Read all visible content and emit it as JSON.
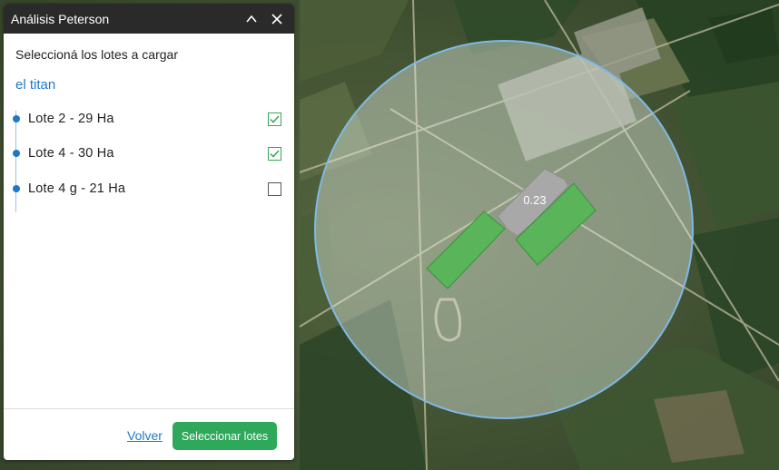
{
  "panel": {
    "title": "Análisis Peterson",
    "instruction": "Seleccioná los lotes a cargar",
    "farm": "el titan",
    "lots": [
      {
        "label": "Lote 2 - 29 Ha",
        "checked": true
      },
      {
        "label": "Lote 4 - 30 Ha",
        "checked": true
      },
      {
        "label": "Lote 4 g - 21 Ha",
        "checked": false
      }
    ],
    "back_label": "Volver",
    "select_label": "Seleccionar lotes"
  },
  "map": {
    "lot_value_label": "0.23"
  },
  "colors": {
    "accent_blue": "#1e78c8",
    "brand_green": "#2ea85a",
    "lot_fill_green": "#5ab45a",
    "header_bg": "#2a2a2a"
  }
}
